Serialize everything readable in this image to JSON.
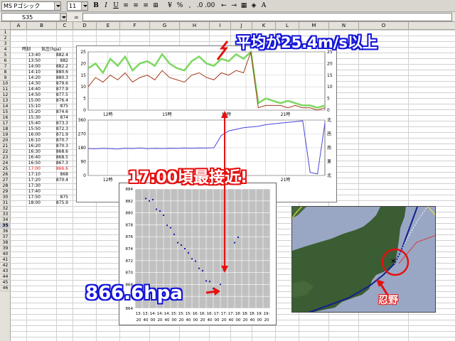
{
  "toolbar": {
    "font_name": "MS Pゴシック",
    "font_size": "11",
    "buttons": [
      "B",
      "I",
      "U",
      "≡",
      "≡",
      "≡",
      "⊞",
      "¥",
      "%",
      ",",
      ".0",
      ".00",
      "⇤",
      "⇥",
      "▦",
      "◈",
      "A"
    ]
  },
  "formula_bar": {
    "name_box": "S35",
    "formula": ""
  },
  "columns": [
    "A",
    "B",
    "C",
    "D",
    "E",
    "F",
    "G",
    "H",
    "I",
    "J",
    "K",
    "L",
    "M",
    "N",
    "O"
  ],
  "rows": [
    "1",
    "2",
    "3",
    "4",
    "5",
    "6",
    "7",
    "8",
    "9",
    "10",
    "11",
    "12",
    "13",
    "14",
    "15",
    "16",
    "17",
    "18",
    "19",
    "20",
    "21",
    "22",
    "23",
    "24",
    "25",
    "26",
    "27",
    "28",
    "29",
    "30",
    "31",
    "32",
    "33",
    "34",
    "35",
    "36",
    "37",
    "38",
    "39",
    "40",
    "41",
    "42",
    "43",
    "44",
    "45",
    "46"
  ],
  "table": {
    "header": {
      "time": "時刻",
      "pressure": "気圧(hpa)"
    },
    "rows": [
      {
        "time": "13:40",
        "pressure": "882.4"
      },
      {
        "time": "13:50",
        "pressure": "882"
      },
      {
        "time": "14:00",
        "pressure": "882.2"
      },
      {
        "time": "14:10",
        "pressure": "880.6"
      },
      {
        "time": "14:20",
        "pressure": "880.3"
      },
      {
        "time": "14:30",
        "pressure": "879.6"
      },
      {
        "time": "14:40",
        "pressure": "877.9"
      },
      {
        "time": "14:50",
        "pressure": "877.5"
      },
      {
        "time": "15:00",
        "pressure": "876.4"
      },
      {
        "time": "15:10",
        "pressure": "875"
      },
      {
        "time": "15:20",
        "pressure": "874.6"
      },
      {
        "time": "15:30",
        "pressure": "874"
      },
      {
        "time": "15:40",
        "pressure": "873.3"
      },
      {
        "time": "15:50",
        "pressure": "872.3"
      },
      {
        "time": "16:00",
        "pressure": "871.9"
      },
      {
        "time": "16:10",
        "pressure": "870.7"
      },
      {
        "time": "16:20",
        "pressure": "870.3"
      },
      {
        "time": "16:30",
        "pressure": "868.6"
      },
      {
        "time": "16:40",
        "pressure": "868.5"
      },
      {
        "time": "16:50",
        "pressure": "867.3"
      },
      {
        "time": "17:00",
        "pressure": "866.6",
        "highlight": true
      },
      {
        "time": "17:10",
        "pressure": "868"
      },
      {
        "time": "17:20",
        "pressure": "870.4"
      },
      {
        "time": "17:30",
        "pressure": ""
      },
      {
        "time": "17:40",
        "pressure": ""
      },
      {
        "time": "17:50",
        "pressure": "875"
      },
      {
        "time": "18:00",
        "pressure": "875.9"
      }
    ]
  },
  "annotations": {
    "wind_note": "平均が25.4m/s以上",
    "closest_note": "17:00頃最接近!",
    "pressure_note": "866.6hpa",
    "place": "忍野"
  },
  "colors": {
    "highlight": "#e51010",
    "blue": "#1515d8",
    "wind_green": "#7cd860",
    "wind_avg": "#a23a18",
    "direction": "#4646d8"
  },
  "chart_data": [
    {
      "type": "line",
      "title": "",
      "x_ticks": [
        "12時",
        "15時",
        "18時",
        "21時"
      ],
      "ylim": [
        0,
        25
      ],
      "y_ticks": [
        "25",
        "20",
        "15",
        "10",
        "5",
        "0"
      ],
      "series": [
        {
          "values": [
            10,
            14,
            12,
            15,
            13,
            16,
            12,
            14,
            15,
            13,
            17,
            14,
            13,
            12,
            15,
            16,
            14,
            13,
            16,
            15,
            17,
            16,
            25,
            1,
            2,
            2,
            2,
            1,
            2,
            1,
            1,
            0,
            1
          ]
        },
        {
          "values": [
            18,
            20,
            16,
            22,
            19,
            23,
            17,
            20,
            21,
            19,
            24,
            20,
            18,
            17,
            21,
            23,
            20,
            19,
            22,
            21,
            24,
            22,
            25,
            3,
            5,
            4,
            3,
            4,
            3,
            2,
            2,
            1,
            2
          ]
        }
      ]
    },
    {
      "type": "line",
      "x_ticks": [
        "12時",
        "15時",
        "18時",
        "21時"
      ],
      "ylim": [
        0,
        360
      ],
      "y_ticks": [
        "360",
        "270",
        "180",
        "90",
        "0"
      ],
      "y_labels_right": [
        "北",
        "西",
        "南",
        "東",
        "北"
      ],
      "series": [
        {
          "values": [
            175,
            173,
            176,
            174,
            172,
            177,
            175,
            178,
            174,
            176,
            175,
            177,
            176,
            178,
            177,
            179,
            178,
            180,
            260,
            290,
            300,
            310,
            315,
            320,
            330,
            335,
            340,
            345,
            350,
            355,
            20,
            10,
            340
          ]
        }
      ]
    },
    {
      "type": "scatter",
      "ylim": [
        864,
        884
      ],
      "y_ticks": [
        "884",
        "882",
        "880",
        "878",
        "876",
        "874",
        "872",
        "870",
        "868",
        "866",
        "864"
      ],
      "x_ticks": [
        [
          "13:",
          "20"
        ],
        [
          "13:",
          "40"
        ],
        [
          "14:",
          "00"
        ],
        [
          "14:",
          "20"
        ],
        [
          "14:",
          "40"
        ],
        [
          "15:",
          "00"
        ],
        [
          "15:",
          "20"
        ],
        [
          "15:",
          "40"
        ],
        [
          "16:",
          "00"
        ],
        [
          "16:",
          "20"
        ],
        [
          "16:",
          "40"
        ],
        [
          "17:",
          "00"
        ],
        [
          "17:",
          "20"
        ],
        [
          "17:",
          "40"
        ],
        [
          "18:",
          "00"
        ],
        [
          "18:",
          "20"
        ],
        [
          "18:",
          "40"
        ],
        [
          "19:",
          "00"
        ],
        [
          "19:",
          "20"
        ]
      ],
      "x": [
        2,
        3,
        4,
        5,
        6,
        7,
        8,
        9,
        10,
        11,
        12,
        13,
        14,
        15,
        16,
        17,
        18,
        19,
        20,
        21,
        22,
        23,
        24,
        27,
        28
      ],
      "y": [
        882.4,
        882,
        882.2,
        880.6,
        880.3,
        879.6,
        877.9,
        877.5,
        876.4,
        875,
        874.6,
        874,
        873.3,
        872.3,
        871.9,
        870.7,
        870.3,
        868.6,
        868.5,
        867.3,
        866.6,
        868,
        870.4,
        875,
        875.9
      ]
    }
  ]
}
